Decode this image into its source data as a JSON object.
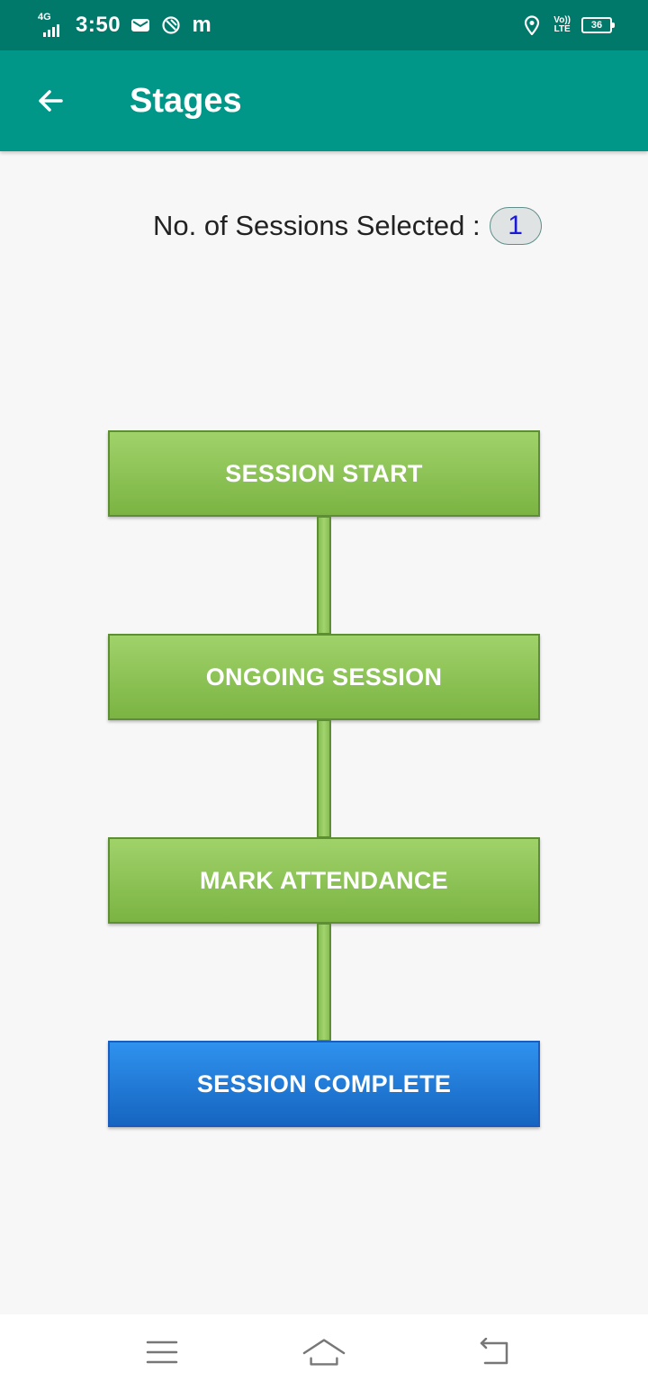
{
  "status_bar": {
    "network": "4G",
    "time": "3:50",
    "volte_top": "Vo))",
    "volte_bottom": "LTE",
    "battery": "36"
  },
  "app_bar": {
    "title": "Stages"
  },
  "sessions": {
    "label": "No. of Sessions Selected :",
    "count": "1"
  },
  "stages": [
    {
      "label": "SESSION START",
      "color": "#8bc34a"
    },
    {
      "label": "ONGOING SESSION",
      "color": "#8bc34a"
    },
    {
      "label": "MARK ATTENDANCE",
      "color": "#8bc34a"
    },
    {
      "label": "SESSION COMPLETE",
      "color": "#1e88e5"
    }
  ],
  "colors": {
    "status_bar": "#00796b",
    "app_bar": "#009688",
    "stage_active": "#8bc34a",
    "stage_complete": "#1e88e5"
  },
  "nav_bar": {
    "icons": [
      "menu-icon",
      "home-icon",
      "back-icon"
    ]
  }
}
